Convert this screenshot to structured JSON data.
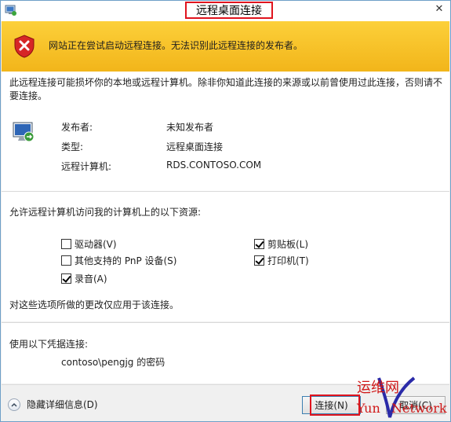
{
  "window": {
    "title": "远程桌面连接",
    "close_glyph": "✕"
  },
  "banner": {
    "text": "网站正在尝试启动远程连接。无法识别此远程连接的发布者。",
    "icon": "shield-error-icon"
  },
  "content": {
    "intro": "此远程连接可能损坏你的本地或远程计算机。除非你知道此连接的来源或以前曾使用过此连接，否则请不要连接。",
    "info": [
      {
        "label": "发布者:",
        "value": "未知发布者"
      },
      {
        "label": "类型:",
        "value": "远程桌面连接"
      },
      {
        "label": "远程计算机:",
        "value": "RDS.CONTOSO.COM"
      }
    ],
    "resources_title": "允许远程计算机访问我的计算机上的以下资源:",
    "resources": [
      {
        "label": "驱动器(V)",
        "checked": false
      },
      {
        "label": "剪贴板(L)",
        "checked": true
      },
      {
        "label": "其他支持的 PnP 设备(S)",
        "checked": false
      },
      {
        "label": "打印机(T)",
        "checked": true
      },
      {
        "label": "录音(A)",
        "checked": true
      }
    ],
    "note": "对这些选项所做的更改仅应用于该连接。"
  },
  "credentials": {
    "title": "使用以下凭据连接:",
    "user": "contoso\\pengjg 的密码"
  },
  "footer": {
    "details_label": "隐藏详细信息(D)",
    "connect_label": "连接(N)",
    "cancel_label": "取消(C)"
  },
  "watermark": {
    "line1": "运维网",
    "line2": "Yun",
    "line3": "Network"
  },
  "colors": {
    "highlight_red": "#e0141e",
    "banner_yellow": "#f7c12a"
  }
}
